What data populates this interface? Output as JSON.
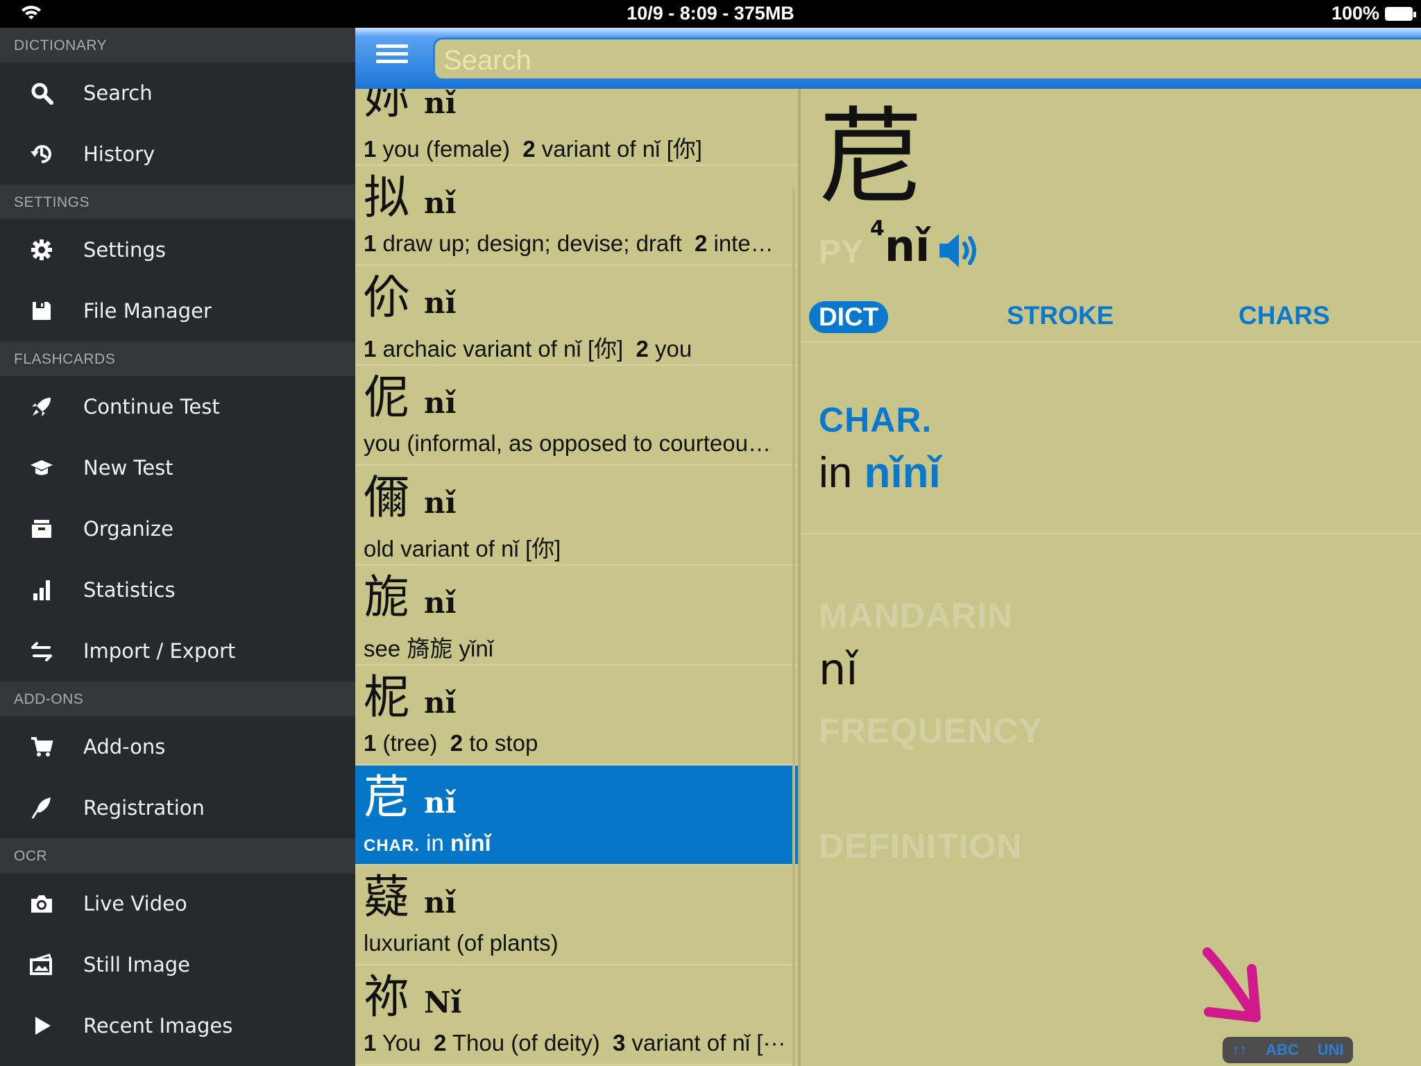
{
  "status_bar": {
    "center": "10/9 - 8:09 - 375MB",
    "battery": "100%"
  },
  "sidebar": {
    "sections": [
      {
        "title": "DICTIONARY",
        "items": [
          {
            "label": "Search",
            "icon": "search-icon"
          },
          {
            "label": "History",
            "icon": "history-icon"
          }
        ]
      },
      {
        "title": "SETTINGS",
        "items": [
          {
            "label": "Settings",
            "icon": "gear-icon"
          },
          {
            "label": "File Manager",
            "icon": "floppy-disk-icon"
          }
        ]
      },
      {
        "title": "FLASHCARDS",
        "items": [
          {
            "label": "Continue Test",
            "icon": "rocket-icon"
          },
          {
            "label": "New Test",
            "icon": "graduation-cap-icon"
          },
          {
            "label": "Organize",
            "icon": "archive-box-icon"
          },
          {
            "label": "Statistics",
            "icon": "bar-chart-icon"
          },
          {
            "label": "Import / Export",
            "icon": "swap-arrows-icon"
          }
        ]
      },
      {
        "title": "ADD-ONS",
        "items": [
          {
            "label": "Add-ons",
            "icon": "cart-icon"
          },
          {
            "label": "Registration",
            "icon": "feather-icon"
          }
        ]
      },
      {
        "title": "OCR",
        "items": [
          {
            "label": "Live Video",
            "icon": "camera-icon"
          },
          {
            "label": "Still Image",
            "icon": "photo-icon"
          },
          {
            "label": "Recent Images",
            "icon": "play-icon"
          }
        ]
      }
    ]
  },
  "search": {
    "placeholder": "Search"
  },
  "results": [
    {
      "hz": "妳",
      "py": "nǐ",
      "def": [
        {
          "n": "1",
          "t": " you (female)  "
        },
        {
          "n": "2",
          "t": " variant of nǐ [你]"
        }
      ]
    },
    {
      "hz": "拟",
      "py": "nǐ",
      "def": [
        {
          "n": "1",
          "t": " draw up; design; devise; draft  "
        },
        {
          "n": "2",
          "t": " inte…"
        }
      ]
    },
    {
      "hz": "伱",
      "py": "nǐ",
      "def": [
        {
          "n": "1",
          "t": " archaic variant of nǐ [你]  "
        },
        {
          "n": "2",
          "t": " you"
        }
      ]
    },
    {
      "hz": "伲",
      "py": "nǐ",
      "def": [
        {
          "n": "",
          "t": "you (informal, as opposed to courteou…"
        }
      ]
    },
    {
      "hz": "儞",
      "py": "nǐ",
      "def": [
        {
          "n": "",
          "t": "old variant of nǐ [你]"
        }
      ]
    },
    {
      "hz": "旎",
      "py": "nǐ",
      "def": [
        {
          "n": "",
          "t": "see 旖旎 yǐnǐ"
        }
      ]
    },
    {
      "hz": "柅",
      "py": "nǐ",
      "def": [
        {
          "n": "1",
          "t": " (tree)  "
        },
        {
          "n": "2",
          "t": " to stop"
        }
      ]
    },
    {
      "hz": "苨",
      "py": "nǐ",
      "def": [
        {
          "n": "CHAR.",
          "t": " in "
        },
        {
          "n": "nǐnǐ",
          "t": ""
        }
      ],
      "selected": true
    },
    {
      "hz": "薿",
      "py": "nǐ",
      "def": [
        {
          "n": "",
          "t": "luxuriant (of plants)"
        }
      ]
    },
    {
      "hz": "祢",
      "py": "Nǐ",
      "def": [
        {
          "n": "1",
          "t": " You  "
        },
        {
          "n": "2",
          "t": " Thou (of deity)  "
        },
        {
          "n": "3",
          "t": " variant of nǐ [··· "
        }
      ]
    }
  ],
  "detail": {
    "hanzi": "苨",
    "py_label": "PY",
    "tone": "4",
    "pinyin": "nǐ",
    "tabs": [
      "DICT",
      "STROKE",
      "CHARS"
    ],
    "char_label": "CHAR.",
    "char_in": "in",
    "char_word": "nǐnǐ",
    "mandarin_label": "MANDARIN",
    "mandarin_value": "nǐ",
    "frequency_label": "FREQUENCY",
    "definition_label": "DEFINITION"
  },
  "keyboard_toggle": {
    "arrows": "↑↑",
    "abc": "ABC",
    "uni": "UNI"
  },
  "colors": {
    "accent": "#0a78cc",
    "background": "#c8c58a",
    "sidebar": "#262a2f",
    "arrow": "#d0198a"
  }
}
